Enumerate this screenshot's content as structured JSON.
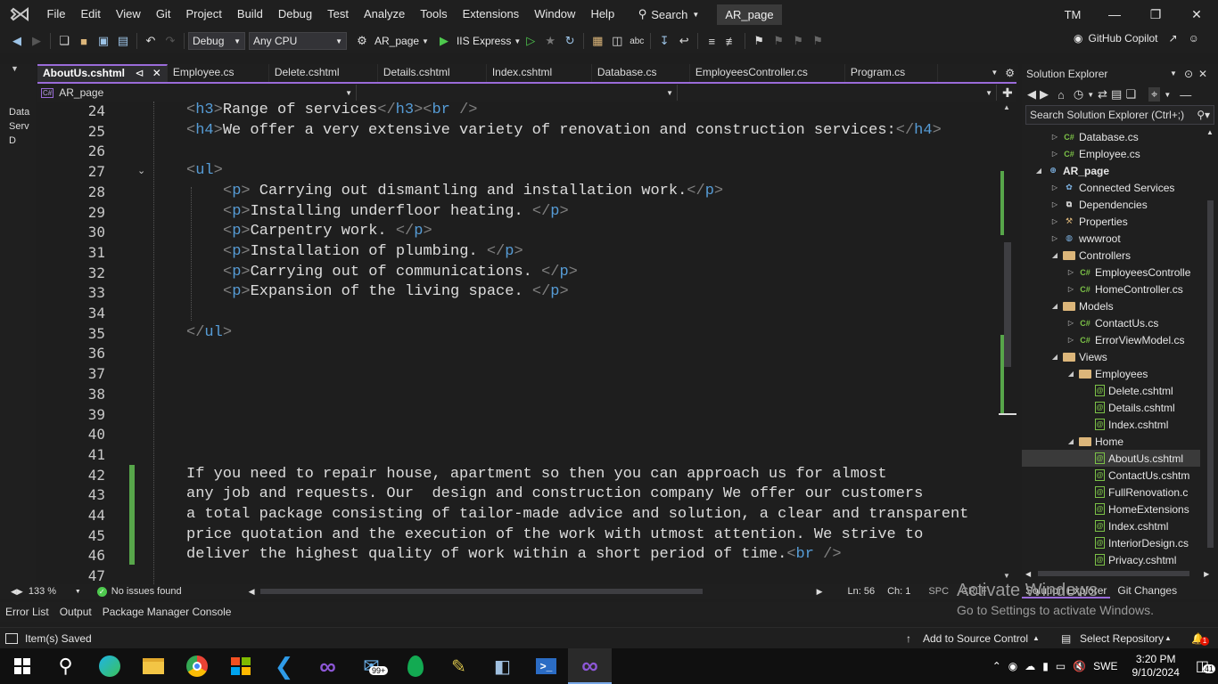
{
  "menubar": {
    "items": [
      "File",
      "Edit",
      "View",
      "Git",
      "Project",
      "Build",
      "Debug",
      "Test",
      "Analyze",
      "Tools",
      "Extensions",
      "Window",
      "Help"
    ],
    "search_label": "Search",
    "project_badge": "AR_page",
    "avatar": "TM"
  },
  "toolbar": {
    "config": "Debug",
    "platform": "Any CPU",
    "startup_project": "AR_page",
    "run_target": "IIS Express",
    "copilot_label": "GitHub Copilot"
  },
  "leftstrip": {
    "items": [
      "Data",
      "Serv",
      "D"
    ]
  },
  "tabs": [
    "AboutUs.cshtml",
    "Employee.cs",
    "Delete.cshtml",
    "Details.cshtml",
    "Index.cshtml",
    "Database.cs",
    "EmployeesController.cs",
    "Program.cs"
  ],
  "nav": {
    "project": "AR_page"
  },
  "editor": {
    "lines": [
      {
        "n": "24",
        "html": "<span class='tag'>&lt;</span><span class='tagname'>h3</span><span class='tag'>&gt;</span>Range of services<span class='tag'>&lt;/</span><span class='tagname'>h3</span><span class='tag'>&gt;&lt;</span><span class='tagname'>br</span> <span class='tag'>/&gt;</span>"
      },
      {
        "n": "25",
        "html": "<span class='tag'>&lt;</span><span class='tagname'>h4</span><span class='tag'>&gt;</span>We offer a very extensive variety of renovation and construction services:<span class='tag'>&lt;/</span><span class='tagname'>h4</span><span class='tag'>&gt;</span>"
      }
    ],
    "code": [
      {
        "n": "24",
        "indent": 0,
        "text": "<h3>Range of services</h3><br />"
      },
      {
        "n": "25",
        "indent": 0,
        "text": "<h4>We offer a very extensive variety of renovation and construction services:</h4>"
      },
      {
        "n": "26",
        "indent": 0,
        "text": ""
      },
      {
        "n": "27",
        "indent": 0,
        "text": "<ul>"
      },
      {
        "n": "28",
        "indent": 1,
        "text": "<p> Carrying out dismantling and installation work.</p>"
      },
      {
        "n": "29",
        "indent": 1,
        "text": "<p>Installing underfloor heating. </p>"
      },
      {
        "n": "30",
        "indent": 1,
        "text": "<p>Carpentry work. </p>"
      },
      {
        "n": "31",
        "indent": 1,
        "text": "<p>Installation of plumbing. </p>"
      },
      {
        "n": "32",
        "indent": 1,
        "text": "<p>Carrying out of communications. </p>"
      },
      {
        "n": "33",
        "indent": 1,
        "text": "<p>Expansion of the living space. </p>"
      },
      {
        "n": "34",
        "indent": 0,
        "text": ""
      },
      {
        "n": "35",
        "indent": 0,
        "text": "</ul>"
      },
      {
        "n": "36",
        "indent": 0,
        "text": ""
      },
      {
        "n": "37",
        "indent": 0,
        "text": ""
      },
      {
        "n": "38",
        "indent": 0,
        "text": ""
      },
      {
        "n": "39",
        "indent": 0,
        "text": ""
      },
      {
        "n": "40",
        "indent": 0,
        "text": ""
      },
      {
        "n": "41",
        "indent": 0,
        "text": ""
      },
      {
        "n": "42",
        "indent": 0,
        "text": "If you need to repair house, apartment so then you can approach us for almost"
      },
      {
        "n": "43",
        "indent": 0,
        "text": "any job and requests. Our  design and construction company We offer our customers"
      },
      {
        "n": "44",
        "indent": 0,
        "text": "a total package consisting of tailor-made advice and solution, a clear and transparent"
      },
      {
        "n": "45",
        "indent": 0,
        "text": "price quotation and the execution of the work with utmost attention. We strive to"
      },
      {
        "n": "46",
        "indent": 0,
        "text": "deliver the highest quality of work within a short period of time.<br />"
      },
      {
        "n": "47",
        "indent": 0,
        "text": ""
      }
    ]
  },
  "edstatus": {
    "zoom": "133 %",
    "issues": "No issues found",
    "ln": "Ln: 56",
    "ch": "Ch: 1",
    "spc": "SPC",
    "crlf": "CRLF"
  },
  "solex": {
    "title": "Solution Explorer",
    "search_placeholder": "Search Solution Explorer (Ctrl+;)",
    "items": [
      {
        "label": "Database.cs",
        "level": 2,
        "icon": "cs",
        "arrow": "▷"
      },
      {
        "label": "Employee.cs",
        "level": 2,
        "icon": "cs",
        "arrow": "▷"
      },
      {
        "label": "AR_page",
        "level": 1,
        "icon": "project",
        "arrow": "◢",
        "bold": true
      },
      {
        "label": "Connected Services",
        "level": 2,
        "icon": "services",
        "arrow": "▷"
      },
      {
        "label": "Dependencies",
        "level": 2,
        "icon": "deps",
        "arrow": "▷"
      },
      {
        "label": "Properties",
        "level": 2,
        "icon": "props",
        "arrow": "▷"
      },
      {
        "label": "wwwroot",
        "level": 2,
        "icon": "globe",
        "arrow": "▷"
      },
      {
        "label": "Controllers",
        "level": 2,
        "icon": "folder",
        "arrow": "◢"
      },
      {
        "label": "EmployeesControlle",
        "level": 3,
        "icon": "cs",
        "arrow": "▷"
      },
      {
        "label": "HomeController.cs",
        "level": 3,
        "icon": "cs",
        "arrow": "▷"
      },
      {
        "label": "Models",
        "level": 2,
        "icon": "folder",
        "arrow": "◢"
      },
      {
        "label": "ContactUs.cs",
        "level": 3,
        "icon": "cs",
        "arrow": "▷"
      },
      {
        "label": "ErrorViewModel.cs",
        "level": 3,
        "icon": "cs",
        "arrow": "▷"
      },
      {
        "label": "Views",
        "level": 2,
        "icon": "folder",
        "arrow": "◢"
      },
      {
        "label": "Employees",
        "level": 3,
        "icon": "folder",
        "arrow": "◢"
      },
      {
        "label": "Delete.cshtml",
        "level": 4,
        "icon": "file",
        "arrow": ""
      },
      {
        "label": "Details.cshtml",
        "level": 4,
        "icon": "file",
        "arrow": ""
      },
      {
        "label": "Index.cshtml",
        "level": 4,
        "icon": "file",
        "arrow": ""
      },
      {
        "label": "Home",
        "level": 3,
        "icon": "folder",
        "arrow": "◢"
      },
      {
        "label": "AboutUs.cshtml",
        "level": 4,
        "icon": "file",
        "arrow": "",
        "selected": true
      },
      {
        "label": "ContactUs.cshtm",
        "level": 4,
        "icon": "file",
        "arrow": ""
      },
      {
        "label": "FullRenovation.c",
        "level": 4,
        "icon": "file",
        "arrow": ""
      },
      {
        "label": "HomeExtensions",
        "level": 4,
        "icon": "file",
        "arrow": ""
      },
      {
        "label": "Index.cshtml",
        "level": 4,
        "icon": "file",
        "arrow": ""
      },
      {
        "label": "InteriorDesign.cs",
        "level": 4,
        "icon": "file",
        "arrow": ""
      },
      {
        "label": "Privacy.cshtml",
        "level": 4,
        "icon": "file",
        "arrow": ""
      }
    ],
    "bottom_tabs": [
      "Solution Explorer",
      "Git Changes"
    ]
  },
  "bottomtabs": [
    "Error List",
    "Output",
    "Package Manager Console"
  ],
  "statusbar": {
    "left": "Item(s) Saved",
    "source_control": "Add to Source Control",
    "repo": "Select Repository",
    "notif_count": "1"
  },
  "watermark": {
    "line1": "Activate Windows",
    "line2": "Go to Settings to activate Windows."
  },
  "taskbar": {
    "badge_mail": "99+",
    "lang": "SWE",
    "time": "3:20 PM",
    "date": "9/10/2024",
    "notif": "41"
  },
  "colors": {
    "accent": "#9a6bd9",
    "change_marker": "#57a64a",
    "tag": "#569cd6"
  }
}
